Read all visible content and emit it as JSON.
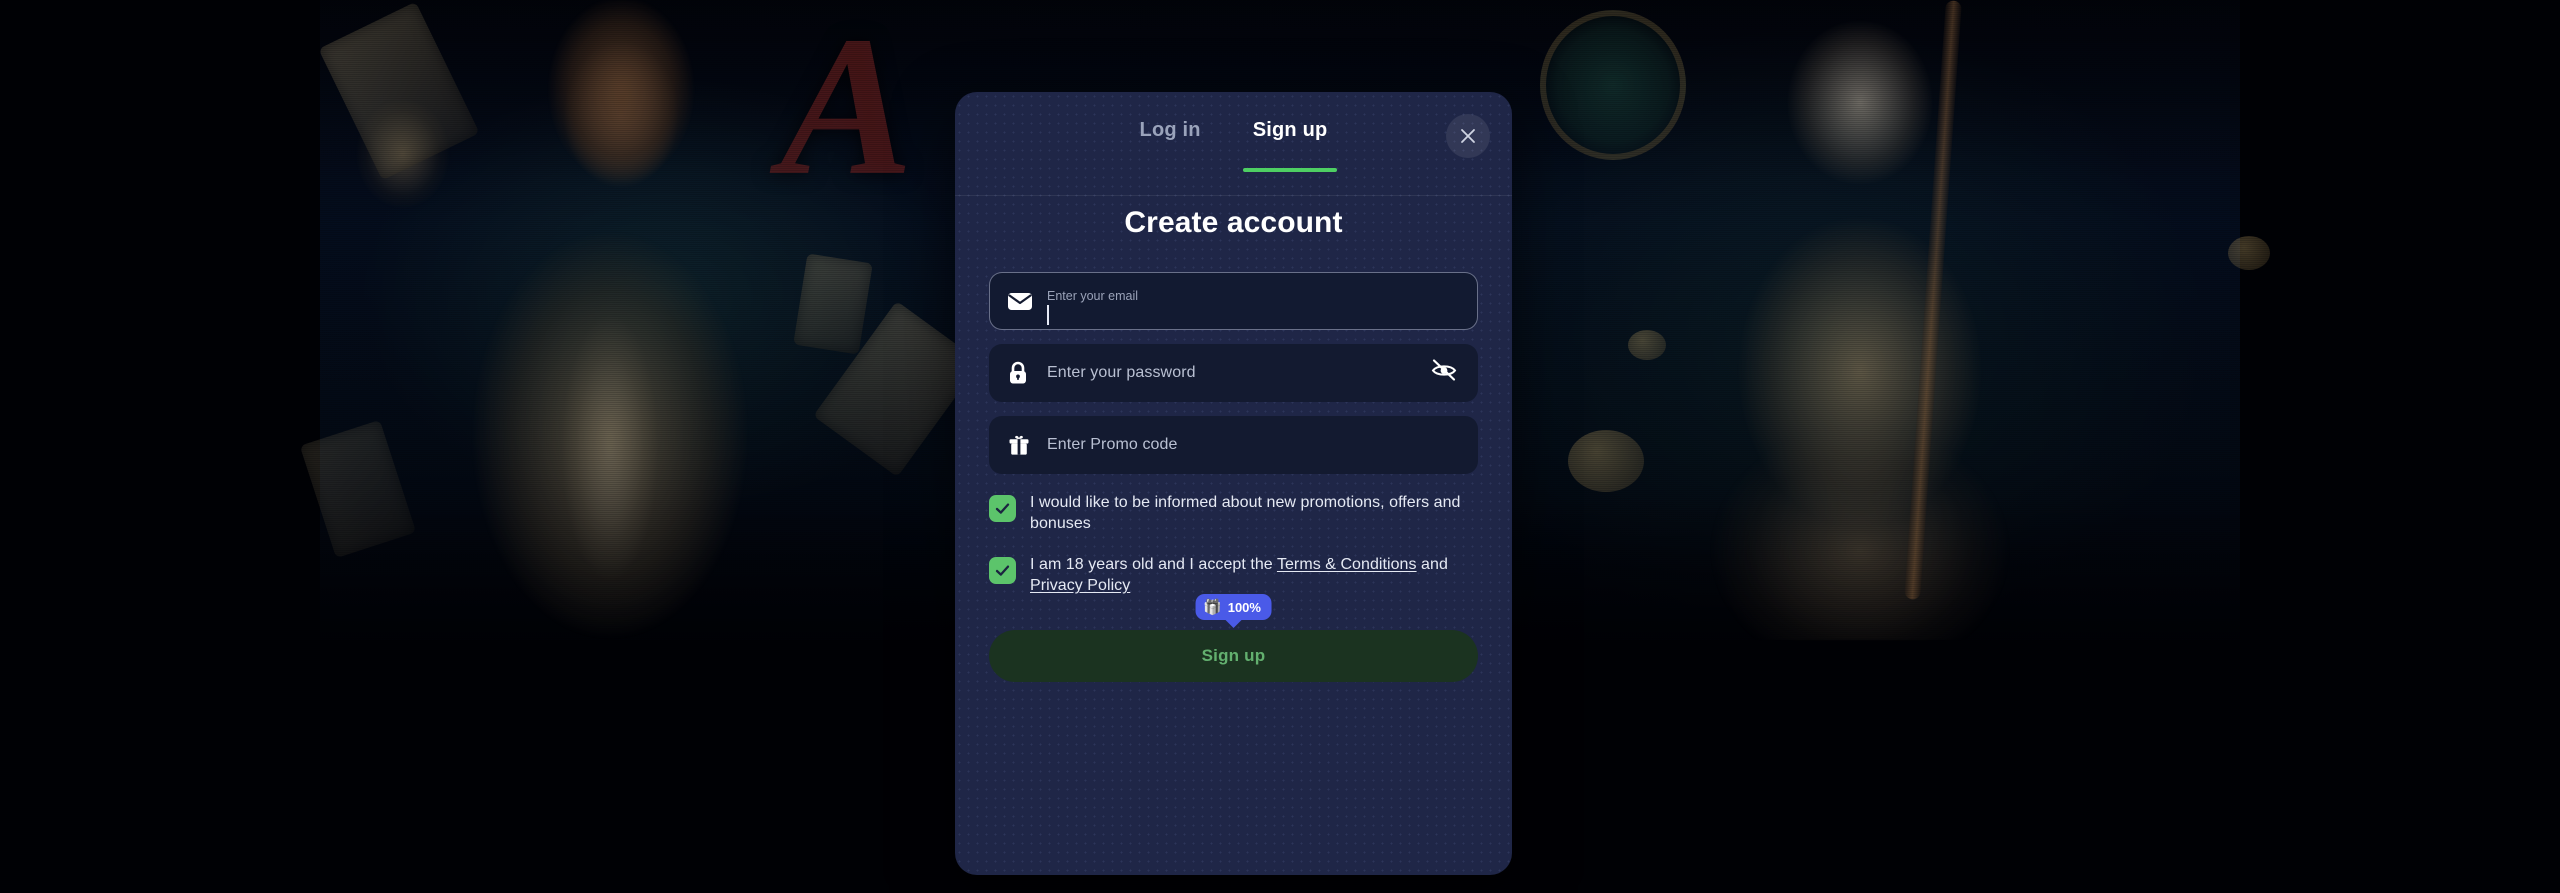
{
  "window": {
    "background_color": "#000105",
    "artwork_description": "darkened casino game artwork: adventurer with cards on the left, Egyptian falcon-headed deity with staff on the right"
  },
  "backdrop": {
    "left_art_name": "adventurer-artwork",
    "right_art_name": "egyptian-deity-artwork",
    "logo_letter": "A"
  },
  "modal": {
    "accent_green": "#4ecf63",
    "surface_color": "#1f2647",
    "field_color": "#131a30",
    "tabs": [
      {
        "label": "Log in",
        "active": false
      },
      {
        "label": "Sign up",
        "active": true
      }
    ],
    "close_icon": "close-icon",
    "title": "Create account",
    "fields": [
      {
        "name": "email",
        "icon": "envelope-icon",
        "label": "Enter your email",
        "placeholder": "Enter your email",
        "value": "",
        "focused": true
      },
      {
        "name": "password",
        "icon": "lock-icon",
        "label": "Enter your password",
        "placeholder": "Enter your password",
        "value": "",
        "focused": false,
        "toggle_icon": "eye-off-icon"
      },
      {
        "name": "promo",
        "icon": "gift-icon",
        "label": "Enter Promo code",
        "placeholder": "Enter Promo code",
        "value": "",
        "focused": false
      }
    ],
    "checkboxes": [
      {
        "name": "marketing-consent",
        "checked": true,
        "text": "I would like to be informed about new promotions, offers and bonuses"
      },
      {
        "name": "age-terms-consent",
        "checked": true,
        "text_prefix": "I am 18 years old and I accept the ",
        "link_terms": "Terms & Conditions",
        "text_middle": " and ",
        "link_privacy": "Privacy Policy"
      }
    ],
    "bonus_badge": {
      "icon": "gift-emoji",
      "emoji": "🎁",
      "value": "100%",
      "color": "#4a5ae8"
    },
    "submit_button": {
      "label": "Sign up",
      "background": "#1b3320",
      "text_color": "#63b06f"
    }
  }
}
